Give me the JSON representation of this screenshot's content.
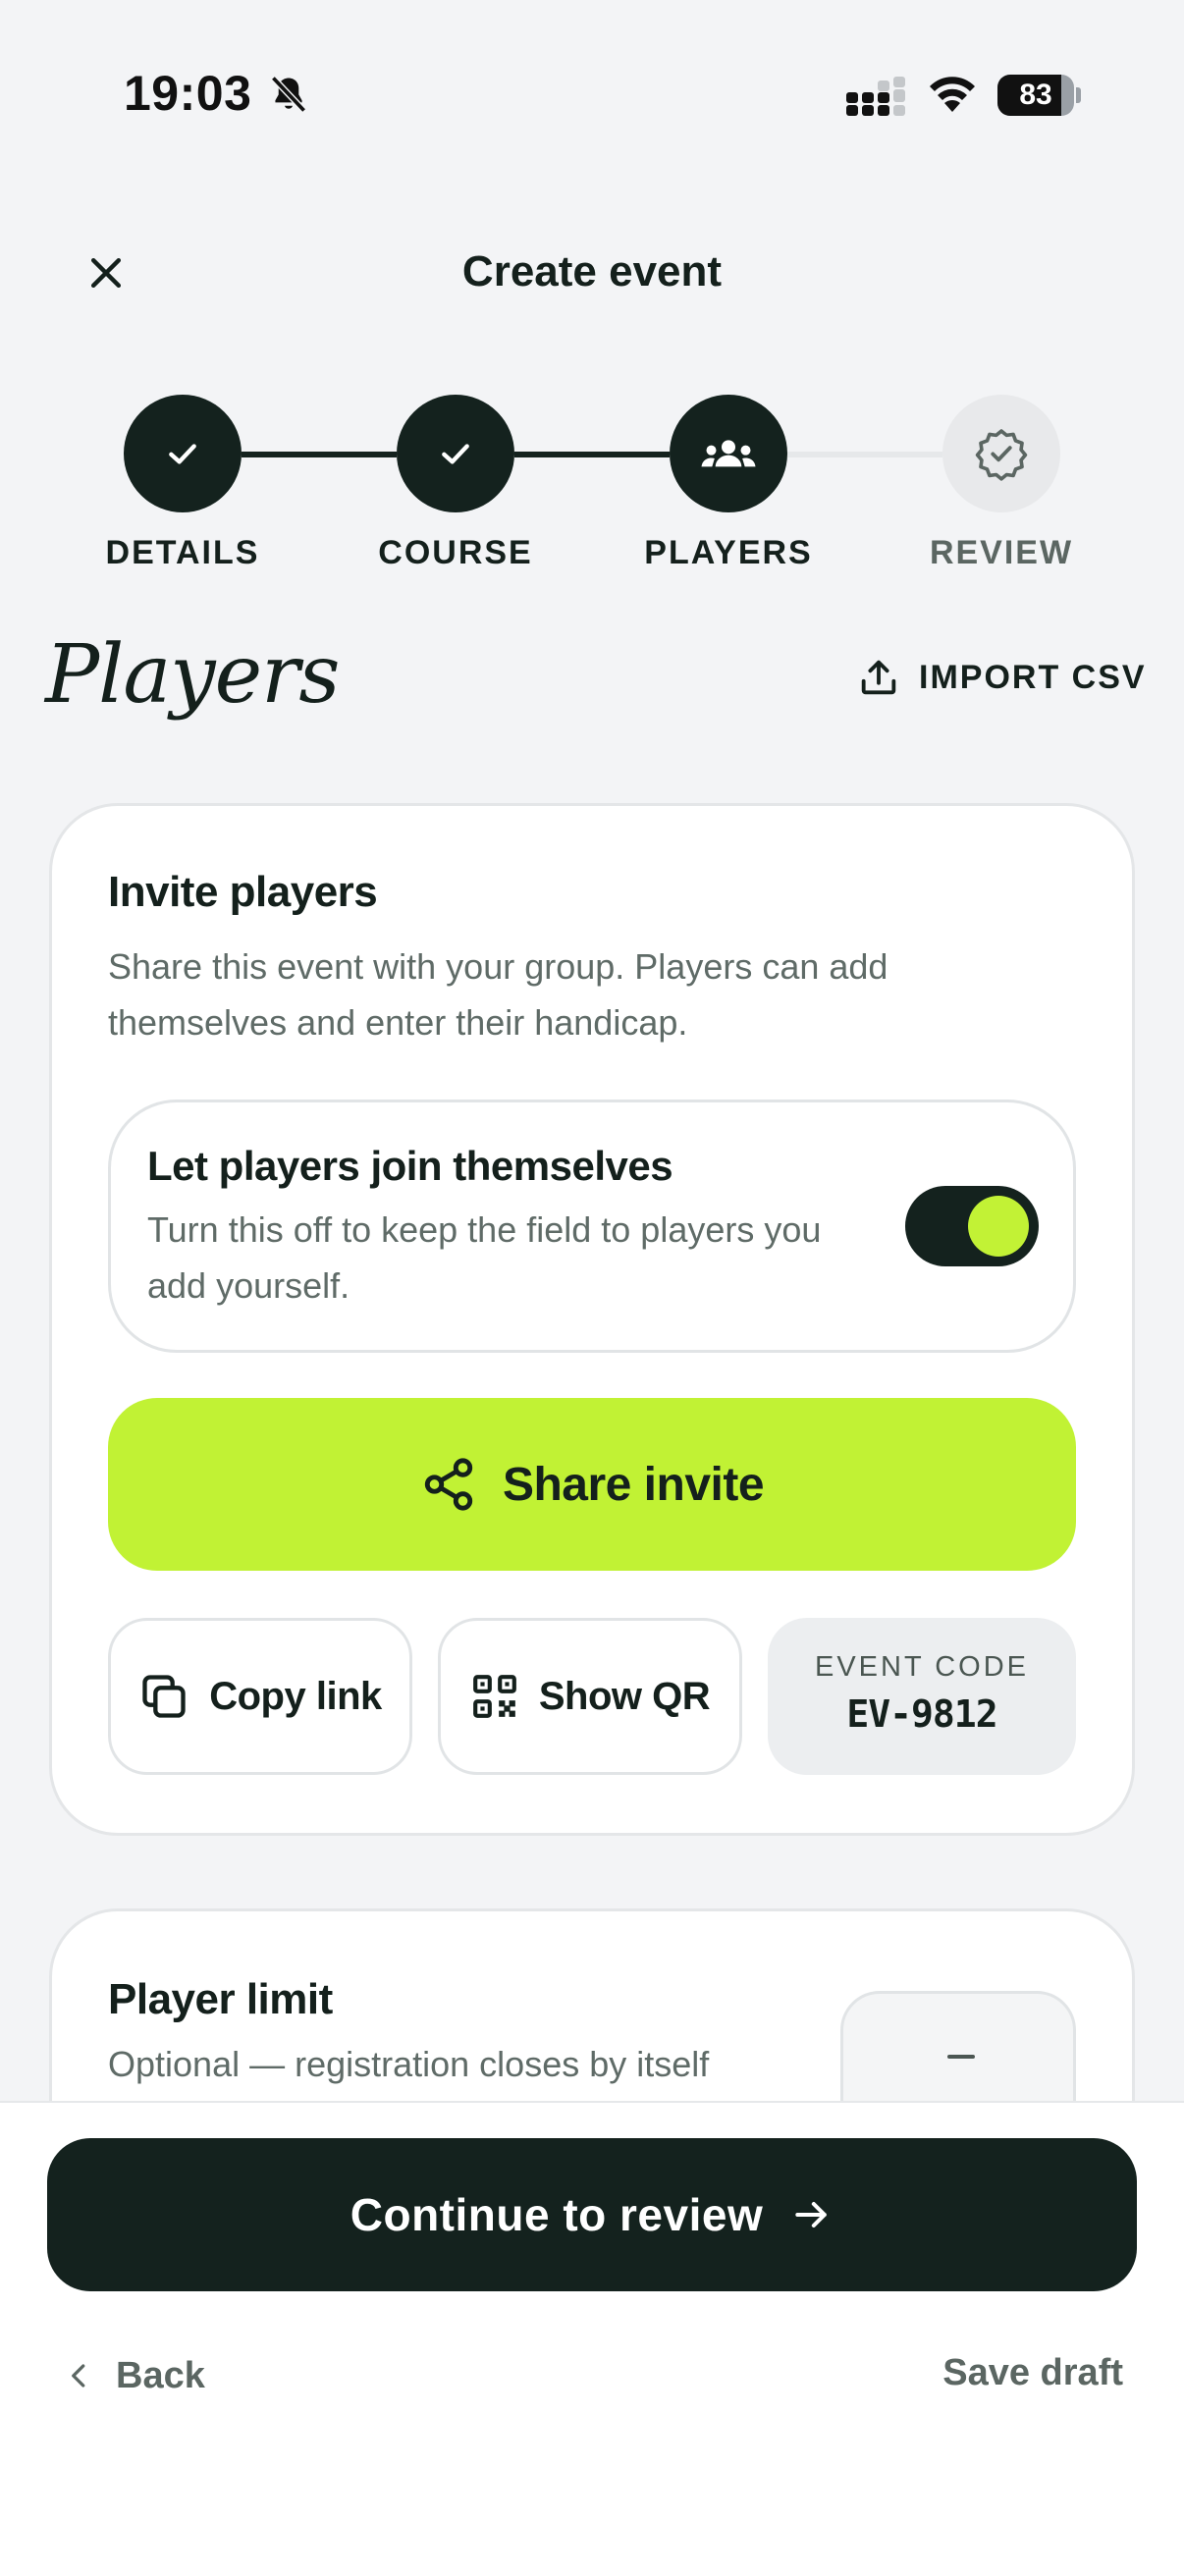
{
  "status_bar": {
    "time": "19:03",
    "battery": "83",
    "battery_level": 0.83
  },
  "header": {
    "title": "Create event"
  },
  "stepper": {
    "steps": [
      {
        "label": "DETAILS",
        "state": "done"
      },
      {
        "label": "COURSE",
        "state": "done"
      },
      {
        "label": "PLAYERS",
        "state": "current"
      },
      {
        "label": "REVIEW",
        "state": "upcoming"
      }
    ]
  },
  "page": {
    "heading": "Players",
    "import_label": "IMPORT CSV"
  },
  "invite": {
    "title": "Invite players",
    "description_line1": "Share this event with your group. Players can add",
    "description_line2": "themselves and enter their handicap.",
    "self_join": {
      "title": "Let players join themselves",
      "description_line1": "Turn this off to keep the field to players you",
      "description_line2": "add yourself.",
      "enabled": true
    },
    "share_label": "Share invite",
    "copy_label": "Copy link",
    "qr_label": "Show QR",
    "code_label": "EVENT CODE",
    "code_value": "EV-9812"
  },
  "limit": {
    "title": "Player limit",
    "description": "Optional — registration closes by itself"
  },
  "footer": {
    "continue_label": "Continue to review",
    "back_label": "Back",
    "save_label": "Save draft"
  },
  "colors": {
    "dark": "#14221e",
    "accent": "#c1f234",
    "muted": "#5f6b67",
    "background": "#f3f4f6"
  },
  "icons": {
    "close": "close-icon",
    "step_done": "check-icon",
    "step_players": "group-icon",
    "step_review": "badge-check-icon",
    "import": "upload-icon",
    "share": "share-icon",
    "copy": "copy-icon",
    "qr": "qr-code-icon",
    "continue": "arrow-right-icon",
    "back": "chevron-left-icon"
  }
}
